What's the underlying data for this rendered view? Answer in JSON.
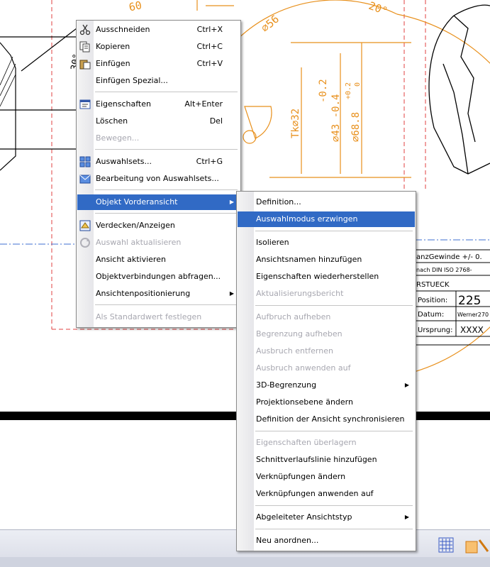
{
  "drawing": {
    "dim_60": "60",
    "dim_30deg": "30°",
    "dim_56": "⌀56",
    "dim_20deg": "20°",
    "dim_tk32": "Tk⌀32",
    "dim_43": "⌀43 -0.4",
    "dim_43b": "-0.2",
    "dim_688": "⌀68.8",
    "dim_688_tol": "+0.2",
    "dim_688_tol0": "0",
    "title_block": {
      "row1": "anzGewinde +/- 0.",
      "row2": "nach DIN ISO 2768-",
      "row3": "RSTUECK",
      "position_label": "Position:",
      "position_value": "225",
      "datum_label": "Datum:",
      "datum_value": "Werner270",
      "ursprung_label": "Ursprung:",
      "ursprung_value": "XXXX"
    }
  },
  "context_menu": {
    "items": [
      {
        "label": "Ausschneiden",
        "shortcut": "Ctrl+X",
        "icon": "scissors-icon"
      },
      {
        "label": "Kopieren",
        "shortcut": "Ctrl+C",
        "icon": "copy-icon"
      },
      {
        "label": "Einfügen",
        "shortcut": "Ctrl+V",
        "icon": "paste-icon"
      },
      {
        "label": "Einfügen Spezial..."
      },
      {
        "label": "Eigenschaften",
        "shortcut": "Alt+Enter",
        "icon": "properties-icon"
      },
      {
        "label": "Löschen",
        "shortcut": "Del"
      },
      {
        "label": "Bewegen..."
      },
      {
        "label": "Auswahlsets...",
        "shortcut": "Ctrl+G",
        "icon": "selection-sets-icon"
      },
      {
        "label": "Bearbeitung von Auswahlsets...",
        "icon": "edit-selection-sets-icon"
      },
      {
        "label": "Objekt Vorderansicht"
      },
      {
        "label": "Verdecken/Anzeigen",
        "icon": "hide-show-icon"
      },
      {
        "label": "Auswahl aktualisieren",
        "icon": "refresh-icon"
      },
      {
        "label": "Ansicht aktivieren"
      },
      {
        "label": "Objektverbindungen abfragen..."
      },
      {
        "label": "Ansichtenpositionierung"
      },
      {
        "label": "Als Standardwert festlegen"
      }
    ]
  },
  "submenu": {
    "items": [
      {
        "label": "Definition..."
      },
      {
        "label": "Auswahlmodus erzwingen"
      },
      {
        "label": "Isolieren"
      },
      {
        "label": "Ansichtsnamen hinzufügen"
      },
      {
        "label": "Eigenschaften wiederherstellen"
      },
      {
        "label": "Aktualisierungsbericht"
      },
      {
        "label": "Aufbruch aufheben"
      },
      {
        "label": "Begrenzung aufheben"
      },
      {
        "label": "Ausbruch entfernen"
      },
      {
        "label": "Ausbruch anwenden auf"
      },
      {
        "label": "3D-Begrenzung"
      },
      {
        "label": "Projektionsebene ändern"
      },
      {
        "label": "Definition der Ansicht synchronisieren"
      },
      {
        "label": "Eigenschaften überlagern"
      },
      {
        "label": "Schnittverlaufslinie hinzufügen"
      },
      {
        "label": "Verknüpfungen ändern"
      },
      {
        "label": "Verknüpfungen anwenden auf"
      },
      {
        "label": "Abgeleiteter Ansichtstyp"
      },
      {
        "label": "Neu anordnen..."
      }
    ]
  },
  "colors": {
    "highlight": "#316ac5",
    "dimension": "#e8901c",
    "frame_red": "#e04040",
    "axis_blue": "#3f6fd0"
  }
}
